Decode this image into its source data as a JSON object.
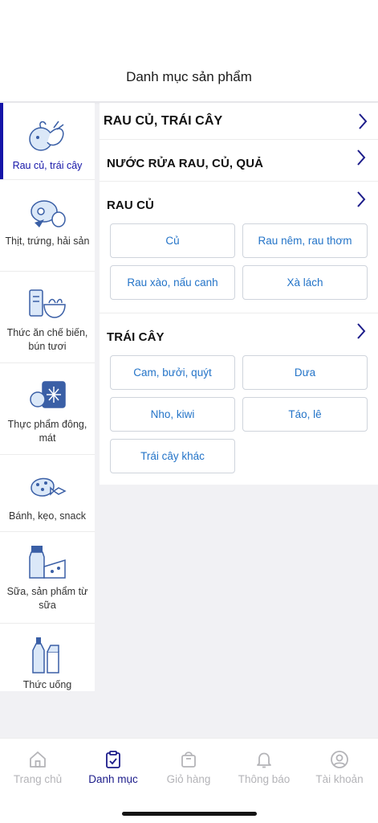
{
  "header": {
    "title": "Danh mục sản phẩm"
  },
  "sidebar": {
    "items": [
      {
        "label": "Rau củ, trái cây",
        "icon": "vegetable-fruit-icon",
        "active": true
      },
      {
        "label": "Thịt, trứng, hải sản",
        "icon": "meat-egg-icon",
        "active": false
      },
      {
        "label": "Thức ăn chế biến, bún tươi",
        "icon": "processed-food-icon",
        "active": false
      },
      {
        "label": "Thực phẩm đông, mát",
        "icon": "frozen-food-icon",
        "active": false
      },
      {
        "label": "Bánh, kẹo, snack",
        "icon": "snack-icon",
        "active": false
      },
      {
        "label": "Sữa, sản phẩm từ sữa",
        "icon": "dairy-icon",
        "active": false
      },
      {
        "label": "Thức uống",
        "icon": "drink-icon",
        "active": false
      }
    ]
  },
  "content": {
    "sections": [
      {
        "title": "RAU CỦ, TRÁI CÂY",
        "chips": []
      },
      {
        "title": "NƯỚC RỬA RAU, CỦ, QUẢ",
        "chips": []
      },
      {
        "title": "RAU CỦ",
        "chips": [
          "Củ",
          "Rau nêm, rau thơm",
          "Rau xào, nấu canh",
          "Xà lách"
        ]
      },
      {
        "title": "TRÁI CÂY",
        "chips": [
          "Cam, bưởi, quýt",
          "Dưa",
          "Nho, kiwi",
          "Táo, lê",
          "Trái cây khác"
        ]
      }
    ]
  },
  "tabbar": {
    "tabs": [
      {
        "label": "Trang chủ",
        "icon": "home-icon",
        "active": false
      },
      {
        "label": "Danh mục",
        "icon": "category-clipboard-icon",
        "active": true
      },
      {
        "label": "Giỏ hàng",
        "icon": "shopping-bag-icon",
        "active": false
      },
      {
        "label": "Thông báo",
        "icon": "bell-icon",
        "active": false
      },
      {
        "label": "Tài khoản",
        "icon": "account-icon",
        "active": false
      }
    ]
  },
  "colors": {
    "accent": "#1414a8",
    "chip_text": "#2474c8",
    "inactive_tab": "#b4b4b8",
    "chevron": "#1c1c8a"
  }
}
